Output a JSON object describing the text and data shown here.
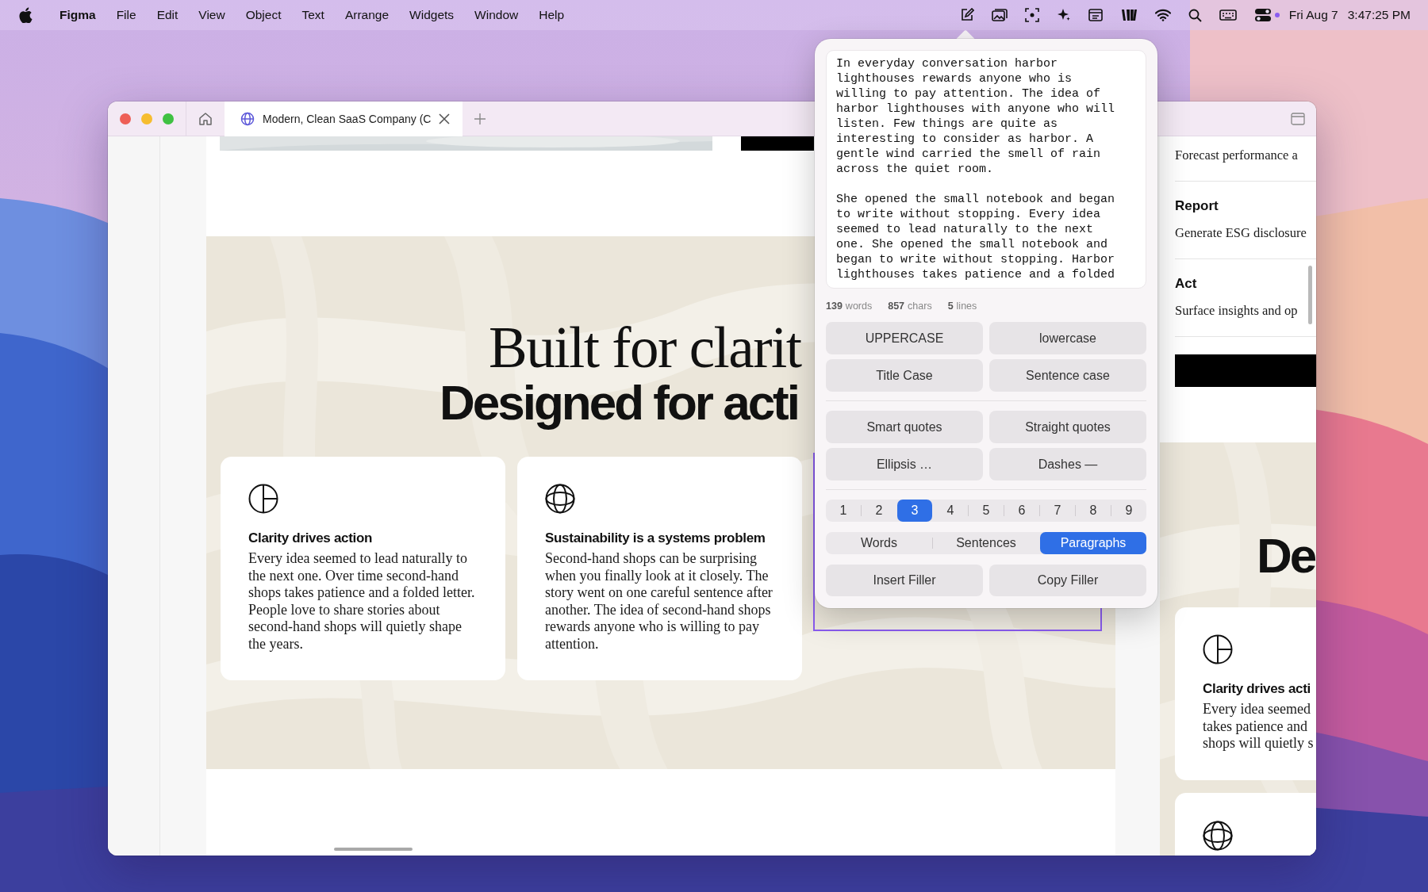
{
  "menu_bar": {
    "app": "Figma",
    "menus": [
      "File",
      "Edit",
      "View",
      "Object",
      "Text",
      "Arrange",
      "Widgets",
      "Window",
      "Help"
    ],
    "date": "Fri Aug 7",
    "time": "3:47:25 PM"
  },
  "browser": {
    "tab": {
      "title": "Modern, Clean SaaS Company (C"
    }
  },
  "frame_1": {
    "heading_lines": [
      "Built for clarit",
      "Designed for acti"
    ],
    "cards": [
      {
        "title": "Clarity drives action",
        "body": "Every idea seemed to lead naturally to the next one. Over time second-hand shops takes patience and a folded letter. People love to share stories about second-hand shops will quietly shape the years."
      },
      {
        "title": "Sustainability is a systems problem",
        "body": "Second-hand shops can be surprising when you finally look at it closely. The story went on one careful sentence after another. The idea of second-hand shops rewards anyone who is willing to pay attention."
      }
    ]
  },
  "frame_2": {
    "intro": "Forecast performance a",
    "steps": [
      {
        "title": "Report",
        "text": "Generate ESG disclosure"
      },
      {
        "title": "Act",
        "text": "Surface insights and op"
      }
    ],
    "heading": "De",
    "card": {
      "title": "Clarity drives acti",
      "body": "Every idea seemed\ntakes patience and\nshops will quietly s"
    }
  },
  "popover": {
    "text": "In everyday conversation harbor lighthouses rewards anyone who is willing to pay attention. The idea of harbor lighthouses with anyone who will listen. Few things are quite as interesting to consider as harbor. A gentle wind carried the smell of rain across the quiet room.\n\nShe opened the small notebook and began to write without stopping. Every idea seemed to lead naturally to the next one. She opened the small notebook and began to write without stopping. Harbor lighthouses takes patience and a folded",
    "stats": [
      {
        "count": "139",
        "unit": "words"
      },
      {
        "count": "857",
        "unit": "chars"
      },
      {
        "count": "5",
        "unit": "lines"
      }
    ],
    "case_buttons": [
      "UPPERCASE",
      "lowercase",
      "Title Case",
      "Sentence case"
    ],
    "punctuation_buttons": [
      "Smart quotes",
      "Straight quotes",
      "Ellipsis …",
      "Dashes —"
    ],
    "counts": [
      {
        "label": "1",
        "selected": false
      },
      {
        "label": "2",
        "selected": false
      },
      {
        "label": "3",
        "selected": true
      },
      {
        "label": "4",
        "selected": false
      },
      {
        "label": "5",
        "selected": false
      },
      {
        "label": "6",
        "selected": false
      },
      {
        "label": "7",
        "selected": false
      },
      {
        "label": "8",
        "selected": false
      },
      {
        "label": "9",
        "selected": false
      }
    ],
    "units": [
      {
        "label": "Words",
        "selected": false
      },
      {
        "label": "Sentences",
        "selected": false
      },
      {
        "label": "Paragraphs",
        "selected": true
      }
    ],
    "actions": [
      "Insert Filler",
      "Copy Filler"
    ]
  }
}
